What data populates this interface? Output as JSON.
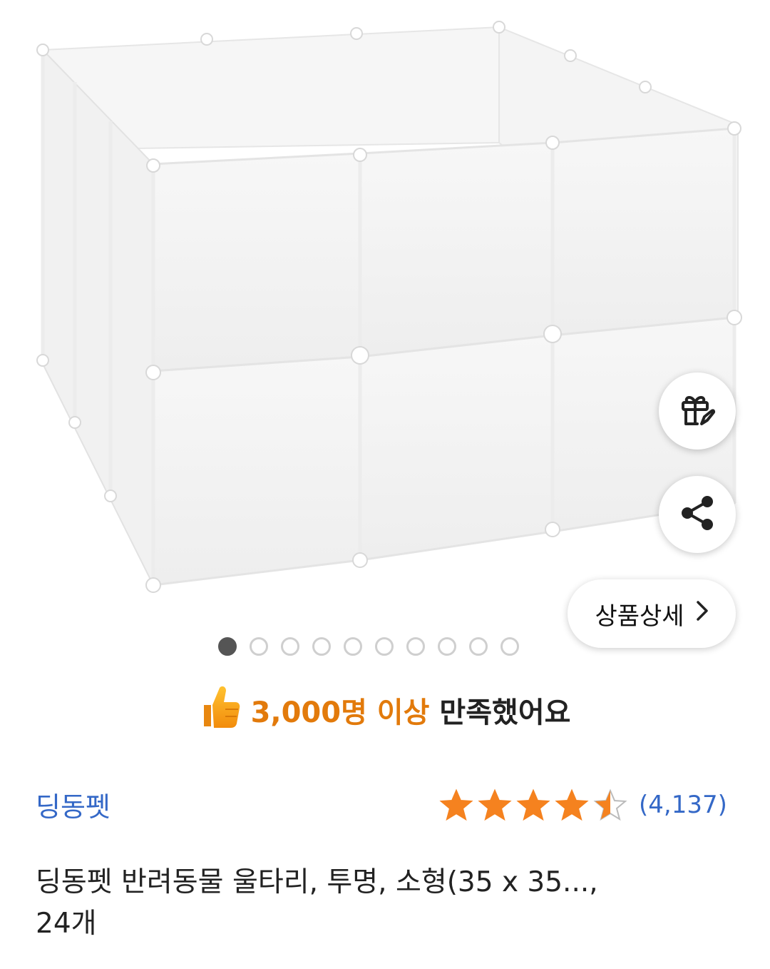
{
  "product": {
    "image_alt": "투명 반려동물 울타리",
    "detail_button_label": "상품상세",
    "gallery": {
      "total": 10,
      "active_index": 0
    }
  },
  "satisfaction": {
    "highlight": "3,000명 이상",
    "rest": "만족했어요",
    "icon": "thumbs-up-icon"
  },
  "seller": {
    "brand": "딩동펫"
  },
  "rating": {
    "stars": 4.5,
    "max": 5,
    "count_text": "(4,137)"
  },
  "title": {
    "line1": "딩동펫 반려동물 울타리, 투명, 소형(35 x 35...,",
    "line2": "24개"
  },
  "colors": {
    "star": "#f5821f",
    "brand_link": "#3468c7",
    "highlight": "#e27a0b"
  }
}
